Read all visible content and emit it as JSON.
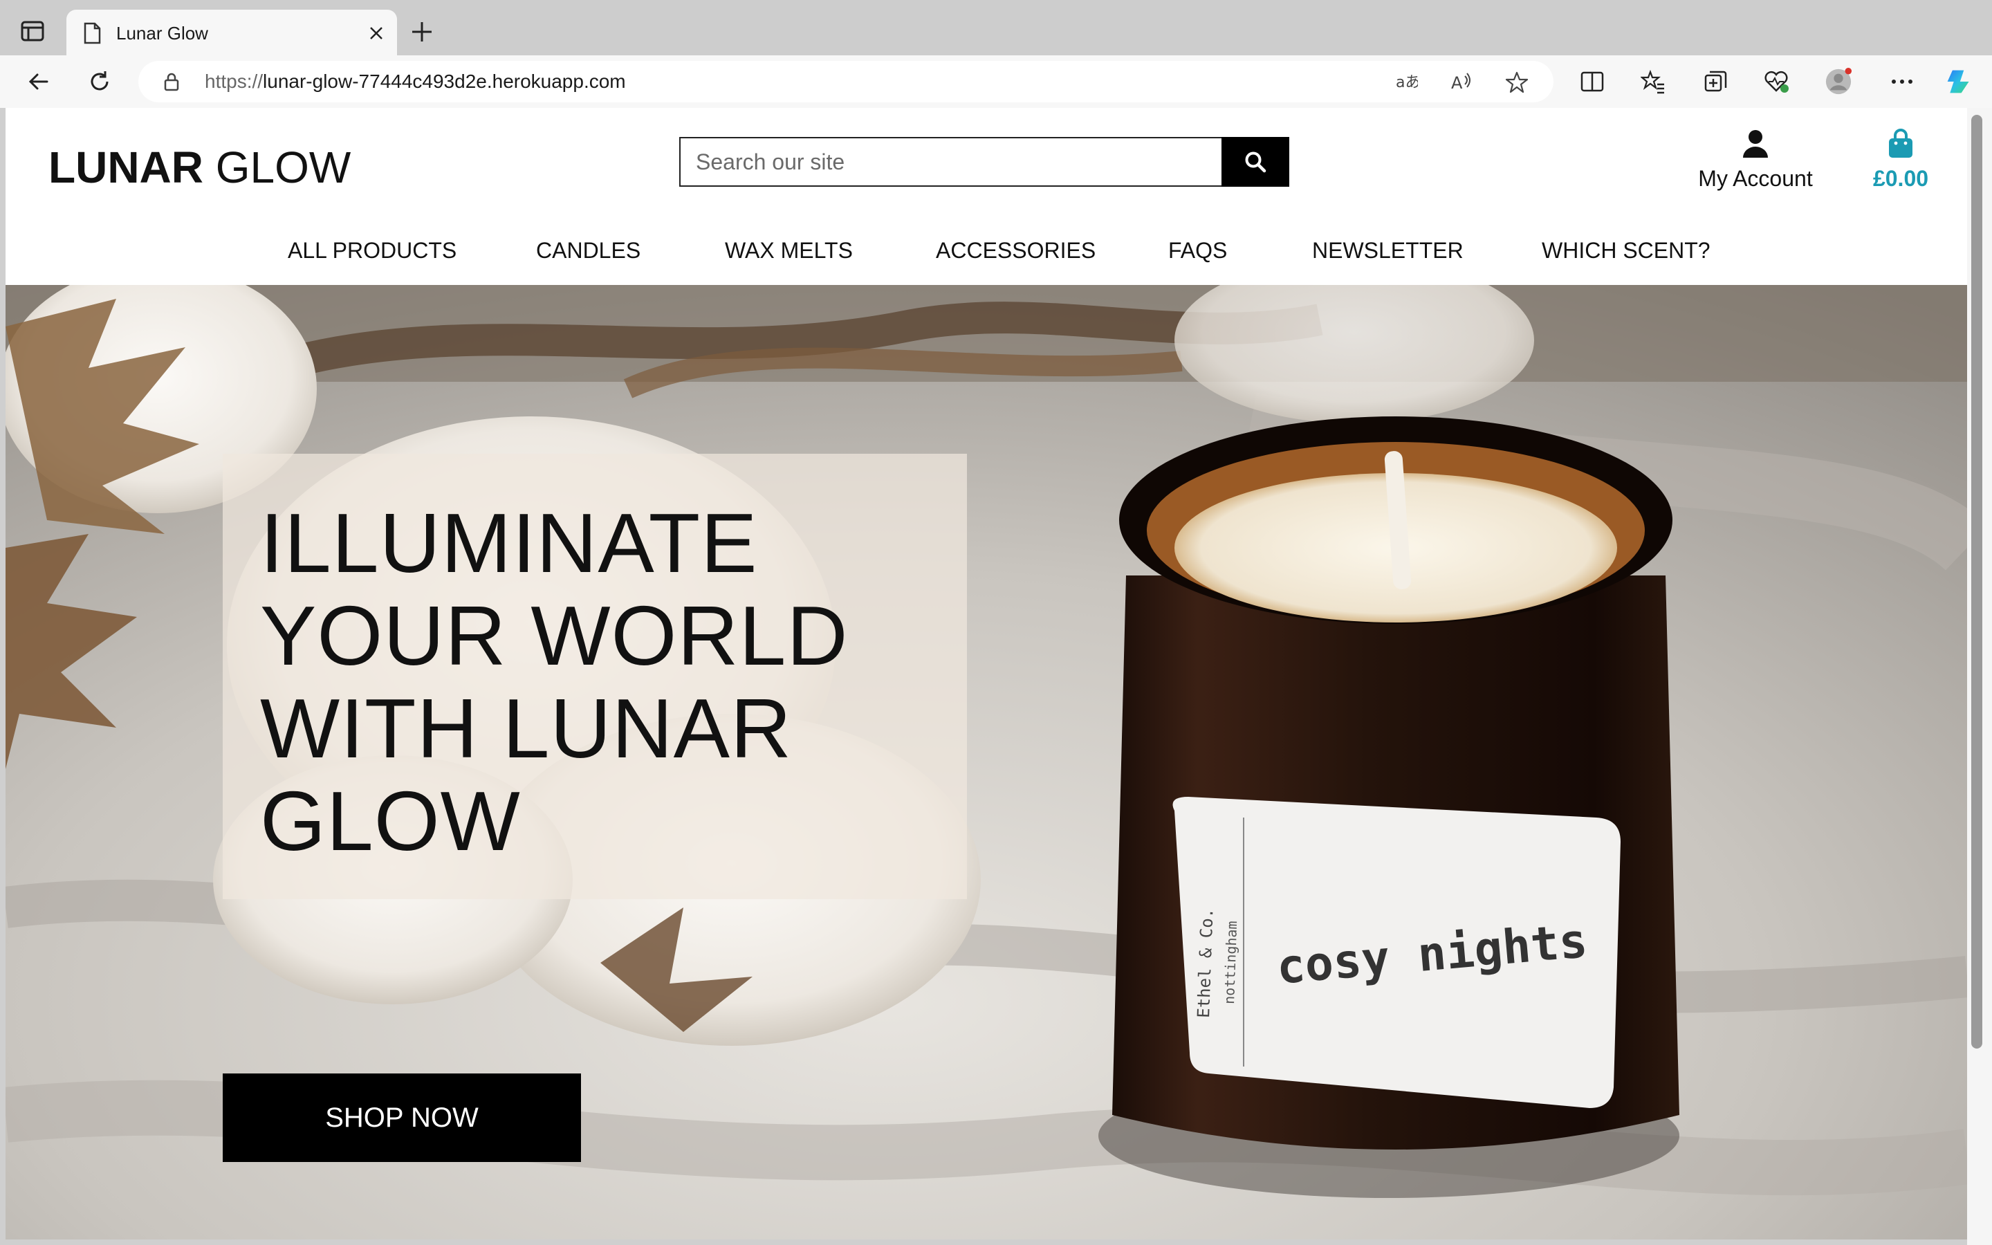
{
  "browser": {
    "tab_title": "Lunar Glow",
    "url_protocol": "https://",
    "url_rest": "lunar-glow-77444c493d2e.herokuapp.com"
  },
  "header": {
    "logo_bold": "LUNAR",
    "logo_light": "GLOW",
    "search_placeholder": "Search our site",
    "account_label": "My Account",
    "bag_total": "£0.00",
    "bag_color": "#1b9bb3"
  },
  "nav": {
    "items": [
      "ALL PRODUCTS",
      "CANDLES",
      "WAX MELTS",
      "ACCESSORIES",
      "FAQS",
      "NEWSLETTER",
      "WHICH SCENT?"
    ]
  },
  "hero": {
    "title": "ILLUMINATE YOUR WORLD WITH LUNAR GLOW",
    "cta_label": "SHOP NOW",
    "candle_label": "cosy nights",
    "candle_brand": "Ethel & Co.",
    "candle_brand_sub": "nottingham"
  }
}
